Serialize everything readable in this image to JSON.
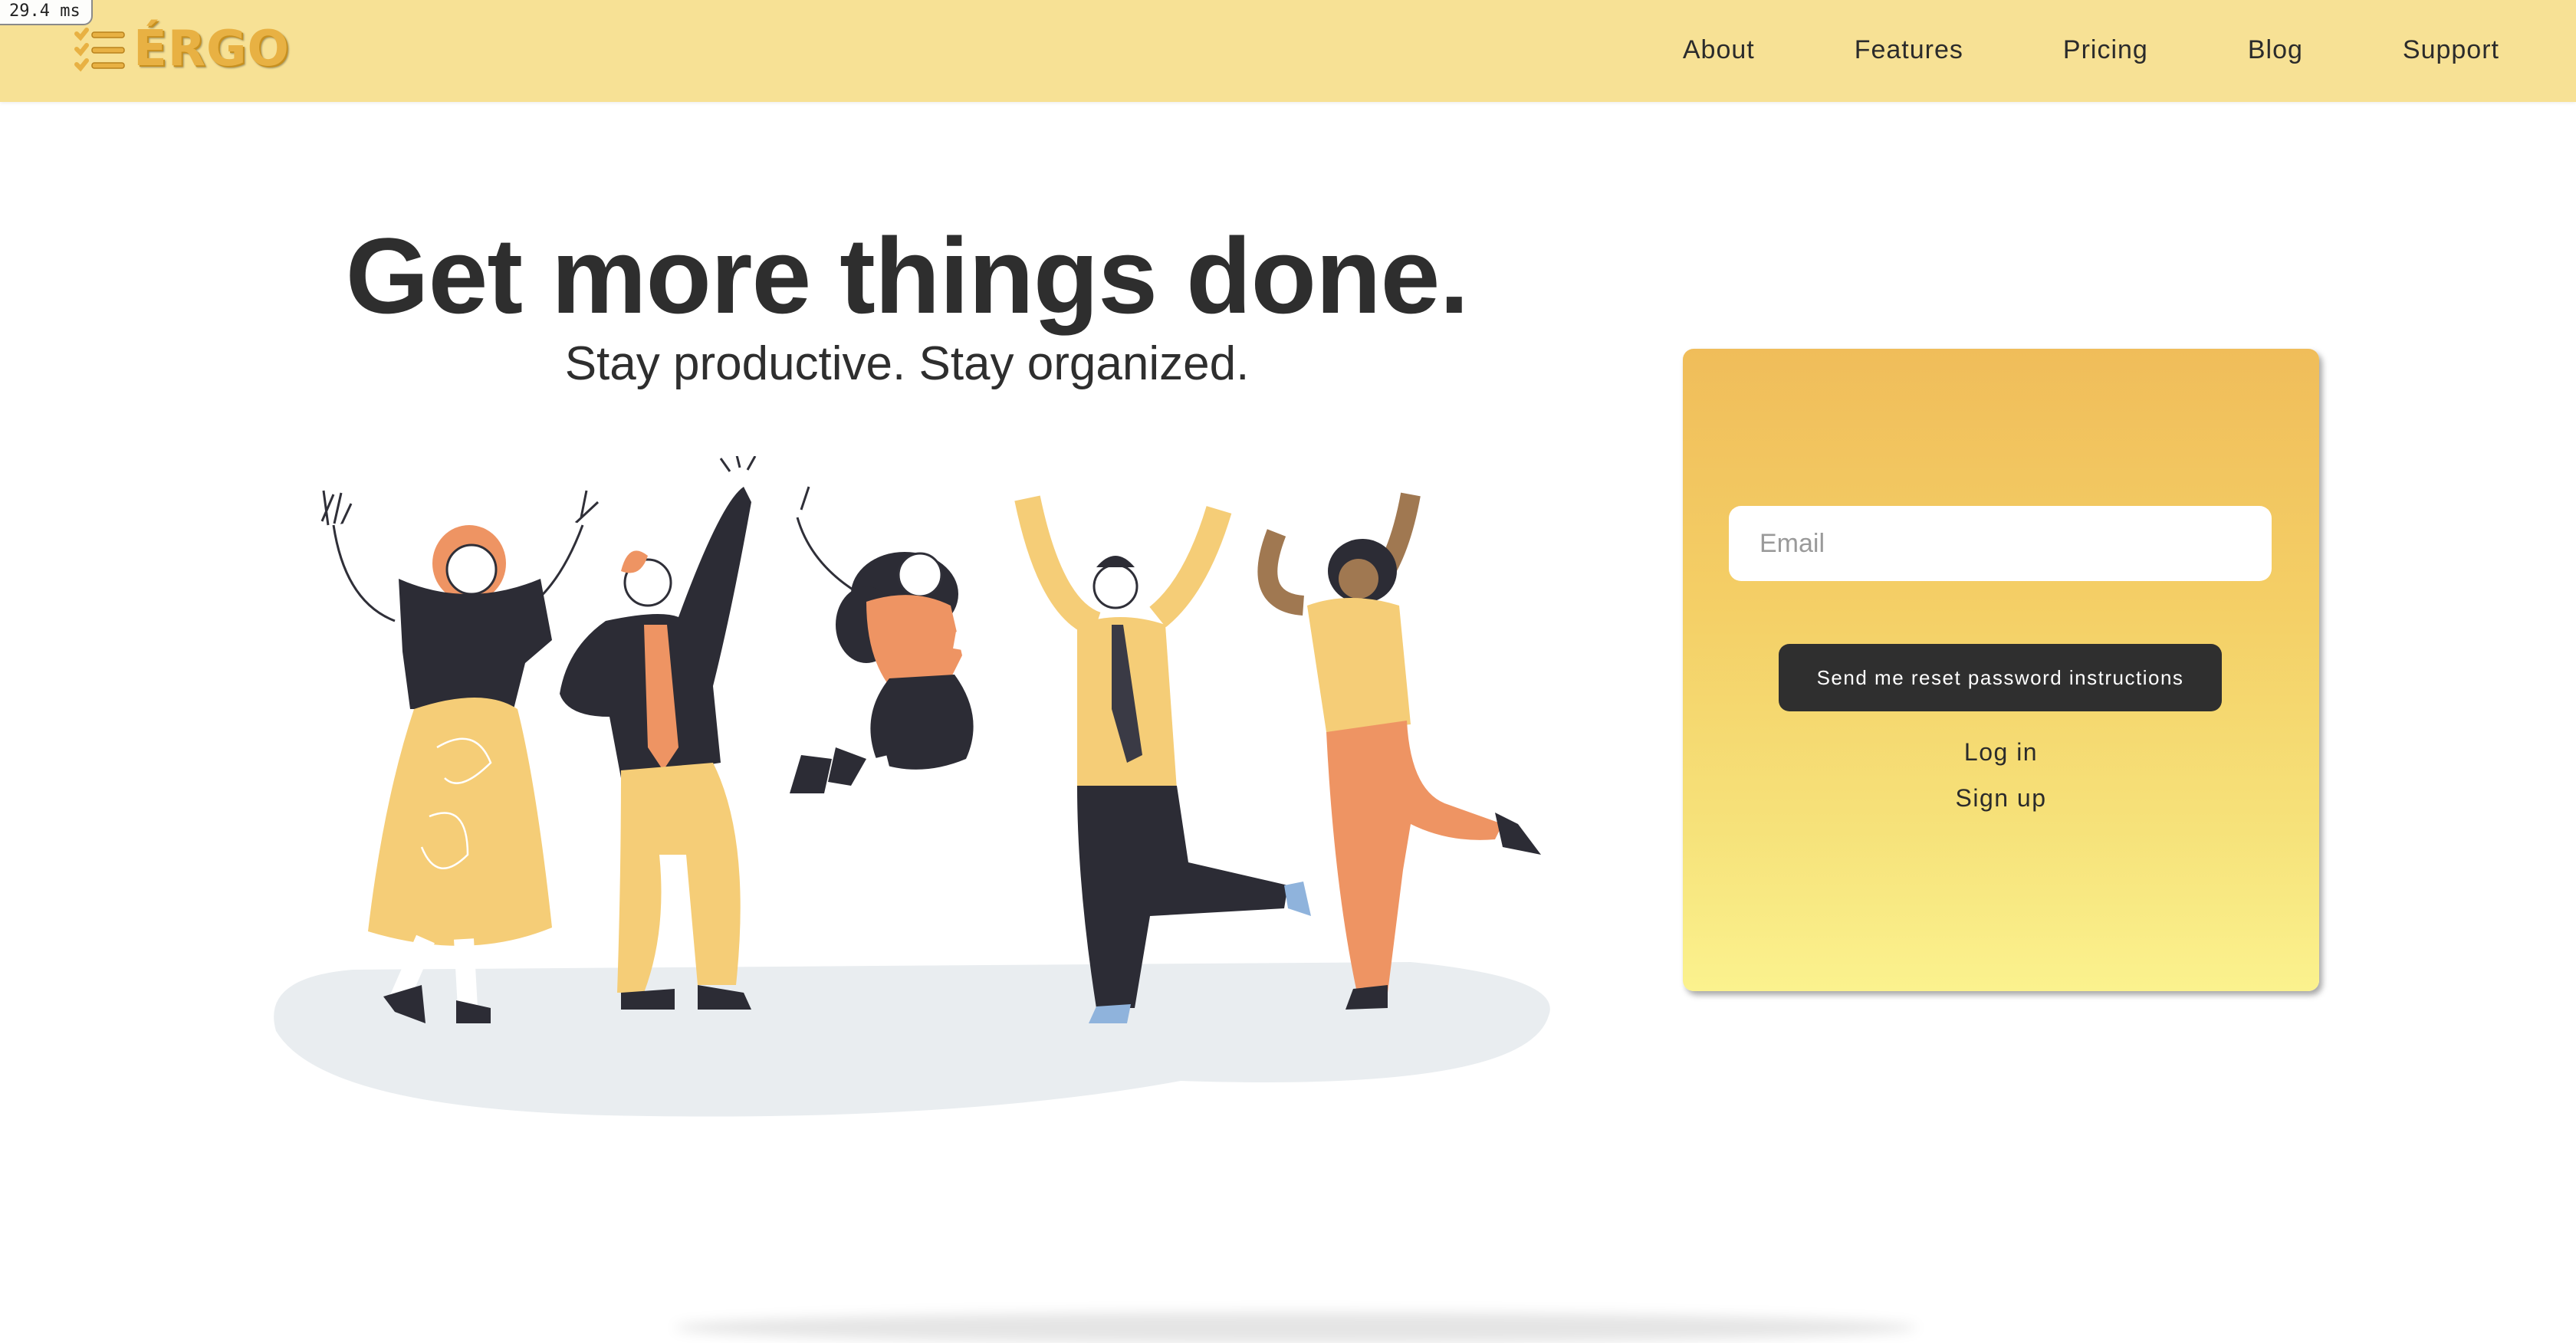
{
  "perf": {
    "label": "29.4 ms"
  },
  "brand": {
    "name": "ÉRGO",
    "color": "#e8b143"
  },
  "nav": {
    "items": [
      {
        "label": "About"
      },
      {
        "label": "Features"
      },
      {
        "label": "Pricing"
      },
      {
        "label": "Blog"
      },
      {
        "label": "Support"
      }
    ]
  },
  "hero": {
    "title": "Get more things done.",
    "subtitle": "Stay productive. Stay organized."
  },
  "form": {
    "email_placeholder": "Email",
    "email_value": "",
    "reset_button": "Send me reset password instructions",
    "login_link": "Log in",
    "signup_link": "Sign up"
  },
  "theme": {
    "header_bg": "#f7e195",
    "panel_gradient_top": "#f0bd5a",
    "panel_gradient_bottom": "#fbf28e",
    "button_bg": "#2f2f2f"
  }
}
